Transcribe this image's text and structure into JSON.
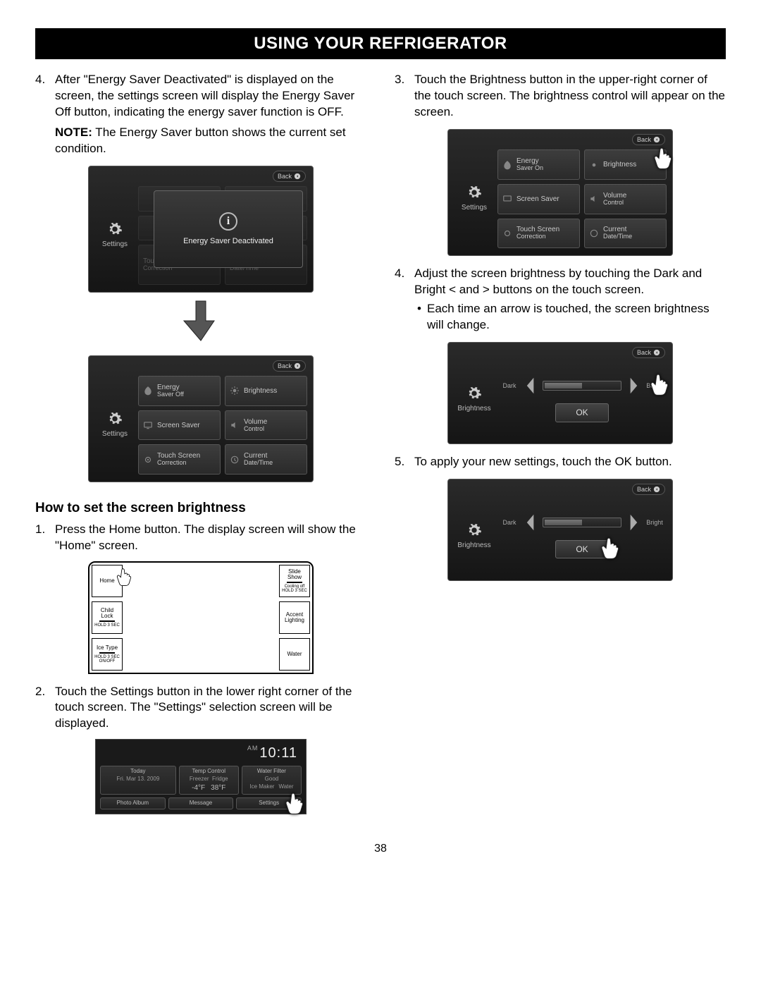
{
  "title_bar": "USING YOUR REFRIGERATOR",
  "page_number": "38",
  "left": {
    "step4": {
      "num": "4.",
      "text": "After \"Energy Saver Deactivated\" is displayed on the screen, the settings screen will display the Energy Saver Off button, indicating the energy saver function is OFF.",
      "note_label": "NOTE:",
      "note_text": " The Energy Saver button shows the current set condition."
    },
    "popup": {
      "back": "Back",
      "side": "Settings",
      "msg": "Energy Saver Deactivated",
      "faded": {
        "a": "Touch Screen",
        "a2": "Correction",
        "b": "Current",
        "b2": "Date/Time"
      }
    },
    "settings_grid": {
      "back": "Back",
      "side": "Settings",
      "cells": {
        "energy1": "Energy",
        "energy2": "Saver Off",
        "bright": "Brightness",
        "screensaver": "Screen Saver",
        "vol1": "Volume",
        "vol2": "Control",
        "tsc1": "Touch Screen",
        "tsc2": "Correction",
        "dt1": "Current",
        "dt2": "Date/Time"
      }
    },
    "subhead": "How to set the screen brightness",
    "step1": {
      "num": "1.",
      "text": "Press the Home button. The display screen will show the \"Home\" screen."
    },
    "home": {
      "home": "Home",
      "child1": "Child",
      "child2": "Lock",
      "child3": "HOLD 3 SEC",
      "ice1": "Ice Type",
      "ice2": "HOLD 3 SEC",
      "ice3": "ON/OFF",
      "slide1": "Slide",
      "slide2": "Show",
      "cool": "Cooling off",
      "cool2": "HOLD 3 SEC",
      "acc1": "Accent",
      "acc2": "Lighting",
      "water": "Water"
    },
    "step2": {
      "num": "2.",
      "text": "Touch the Settings button in the lower right corner of the touch screen. The \"Settings\" selection screen will be displayed."
    },
    "status": {
      "ampm": "AM",
      "clock": "10:11",
      "today": "Today",
      "date": "Fri. Mar 13. 2009",
      "temp": "Temp",
      "control": "Control",
      "freezer": "Freezer",
      "fridge": "Fridge",
      "t1": "-4°F",
      "t2": "38°F",
      "filter": "Water Filter",
      "good": "Good",
      "icemaker": "Ice Maker",
      "water": "Water",
      "photo": "Photo Album",
      "message": "Message",
      "settings": "Settings"
    }
  },
  "right": {
    "step3": {
      "num": "3.",
      "text": "Touch the Brightness button in the upper-right corner of the touch screen. The brightness control will appear on the screen."
    },
    "settings_grid": {
      "back": "Back",
      "side": "Settings",
      "cells": {
        "energy1": "Energy",
        "energy2": "Saver On",
        "bright": "Brightness",
        "screensaver": "Screen Saver",
        "vol1": "Volume",
        "vol2": "Control",
        "tsc1": "Touch Screen",
        "tsc2": "Correction",
        "dt1": "Current",
        "dt2": "Date/Time"
      }
    },
    "step4": {
      "num": "4.",
      "text": "Adjust the screen brightness by touching the Dark and Bright < and > buttons on the touch screen.",
      "bullet": "Each time an arrow is touched, the screen brightness will change."
    },
    "bright": {
      "back": "Back",
      "side": "Brightness",
      "dark": "Dark",
      "brightlbl": "Bright",
      "ok": "OK"
    },
    "step5": {
      "num": "5.",
      "text": "To apply your new settings, touch the OK button."
    }
  }
}
